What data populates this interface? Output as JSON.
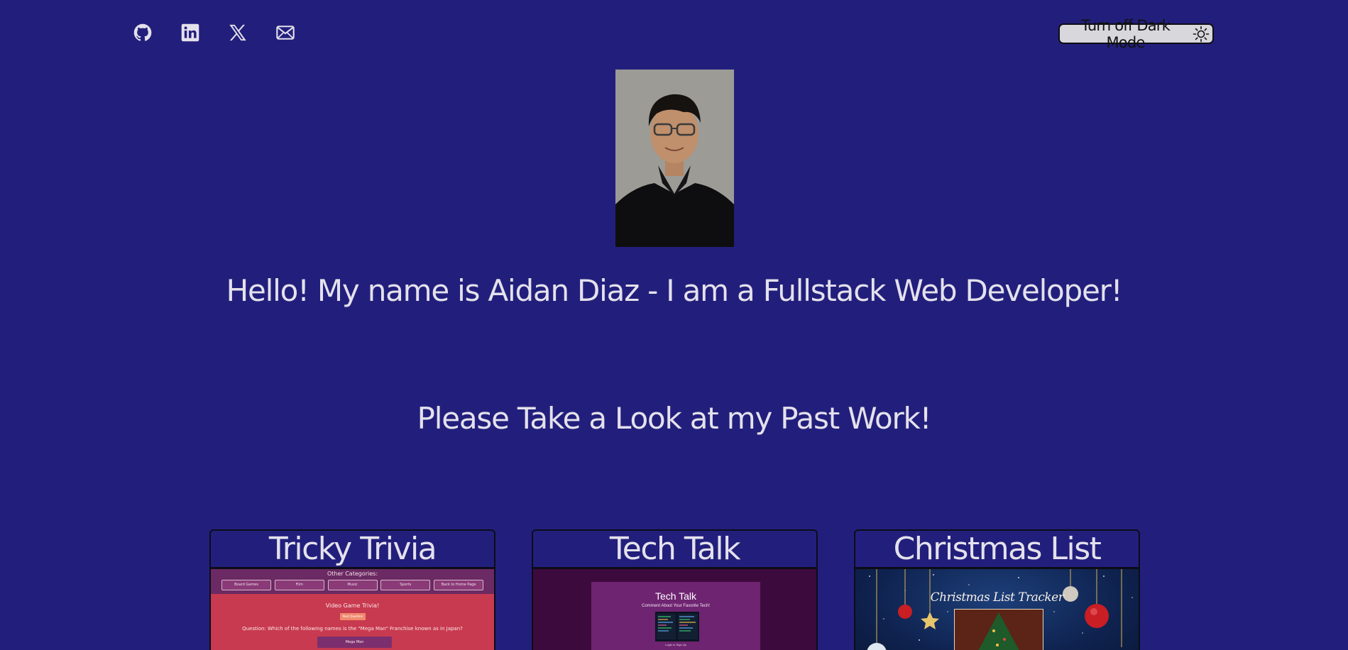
{
  "social": [
    {
      "name": "github-icon",
      "label": "GitHub"
    },
    {
      "name": "linkedin-icon",
      "label": "LinkedIn"
    },
    {
      "name": "x-icon",
      "label": "X"
    },
    {
      "name": "mail-icon",
      "label": "Email"
    }
  ],
  "theme_toggle": {
    "label": "Turn off Dark Mode",
    "icon": "sun-icon"
  },
  "colors": {
    "background": "#221f7c",
    "text": "#e4e1ec",
    "toggle_bg": "#d8d8dc",
    "card_border": "#0c0c18"
  },
  "profile": {
    "headline": "Hello! My name is Aidan Diaz - I am a Fullstack Web Developer!"
  },
  "work": {
    "heading": "Please Take a Look at my Past Work!"
  },
  "projects": [
    {
      "title": "Tricky Trivia",
      "preview": {
        "categories_label": "Other Categories:",
        "category_buttons": [
          "Board Games",
          "Film",
          "Music",
          "Sports",
          "Back to Home Page"
        ],
        "heading": "Video Game Trivia!",
        "start_label": "Next Question",
        "question": "Question: Which of the following names is the \"Mega Man\" Franchise known as in Japan?",
        "answer": "Mega Man"
      }
    },
    {
      "title": "Tech Talk",
      "preview": {
        "title": "Tech Talk",
        "subtitle": "Comment About Your Favorite Tech!",
        "links": "Login or Sign Up"
      }
    },
    {
      "title": "Christmas List",
      "preview": {
        "title": "Christmas List Tracker"
      }
    }
  ]
}
